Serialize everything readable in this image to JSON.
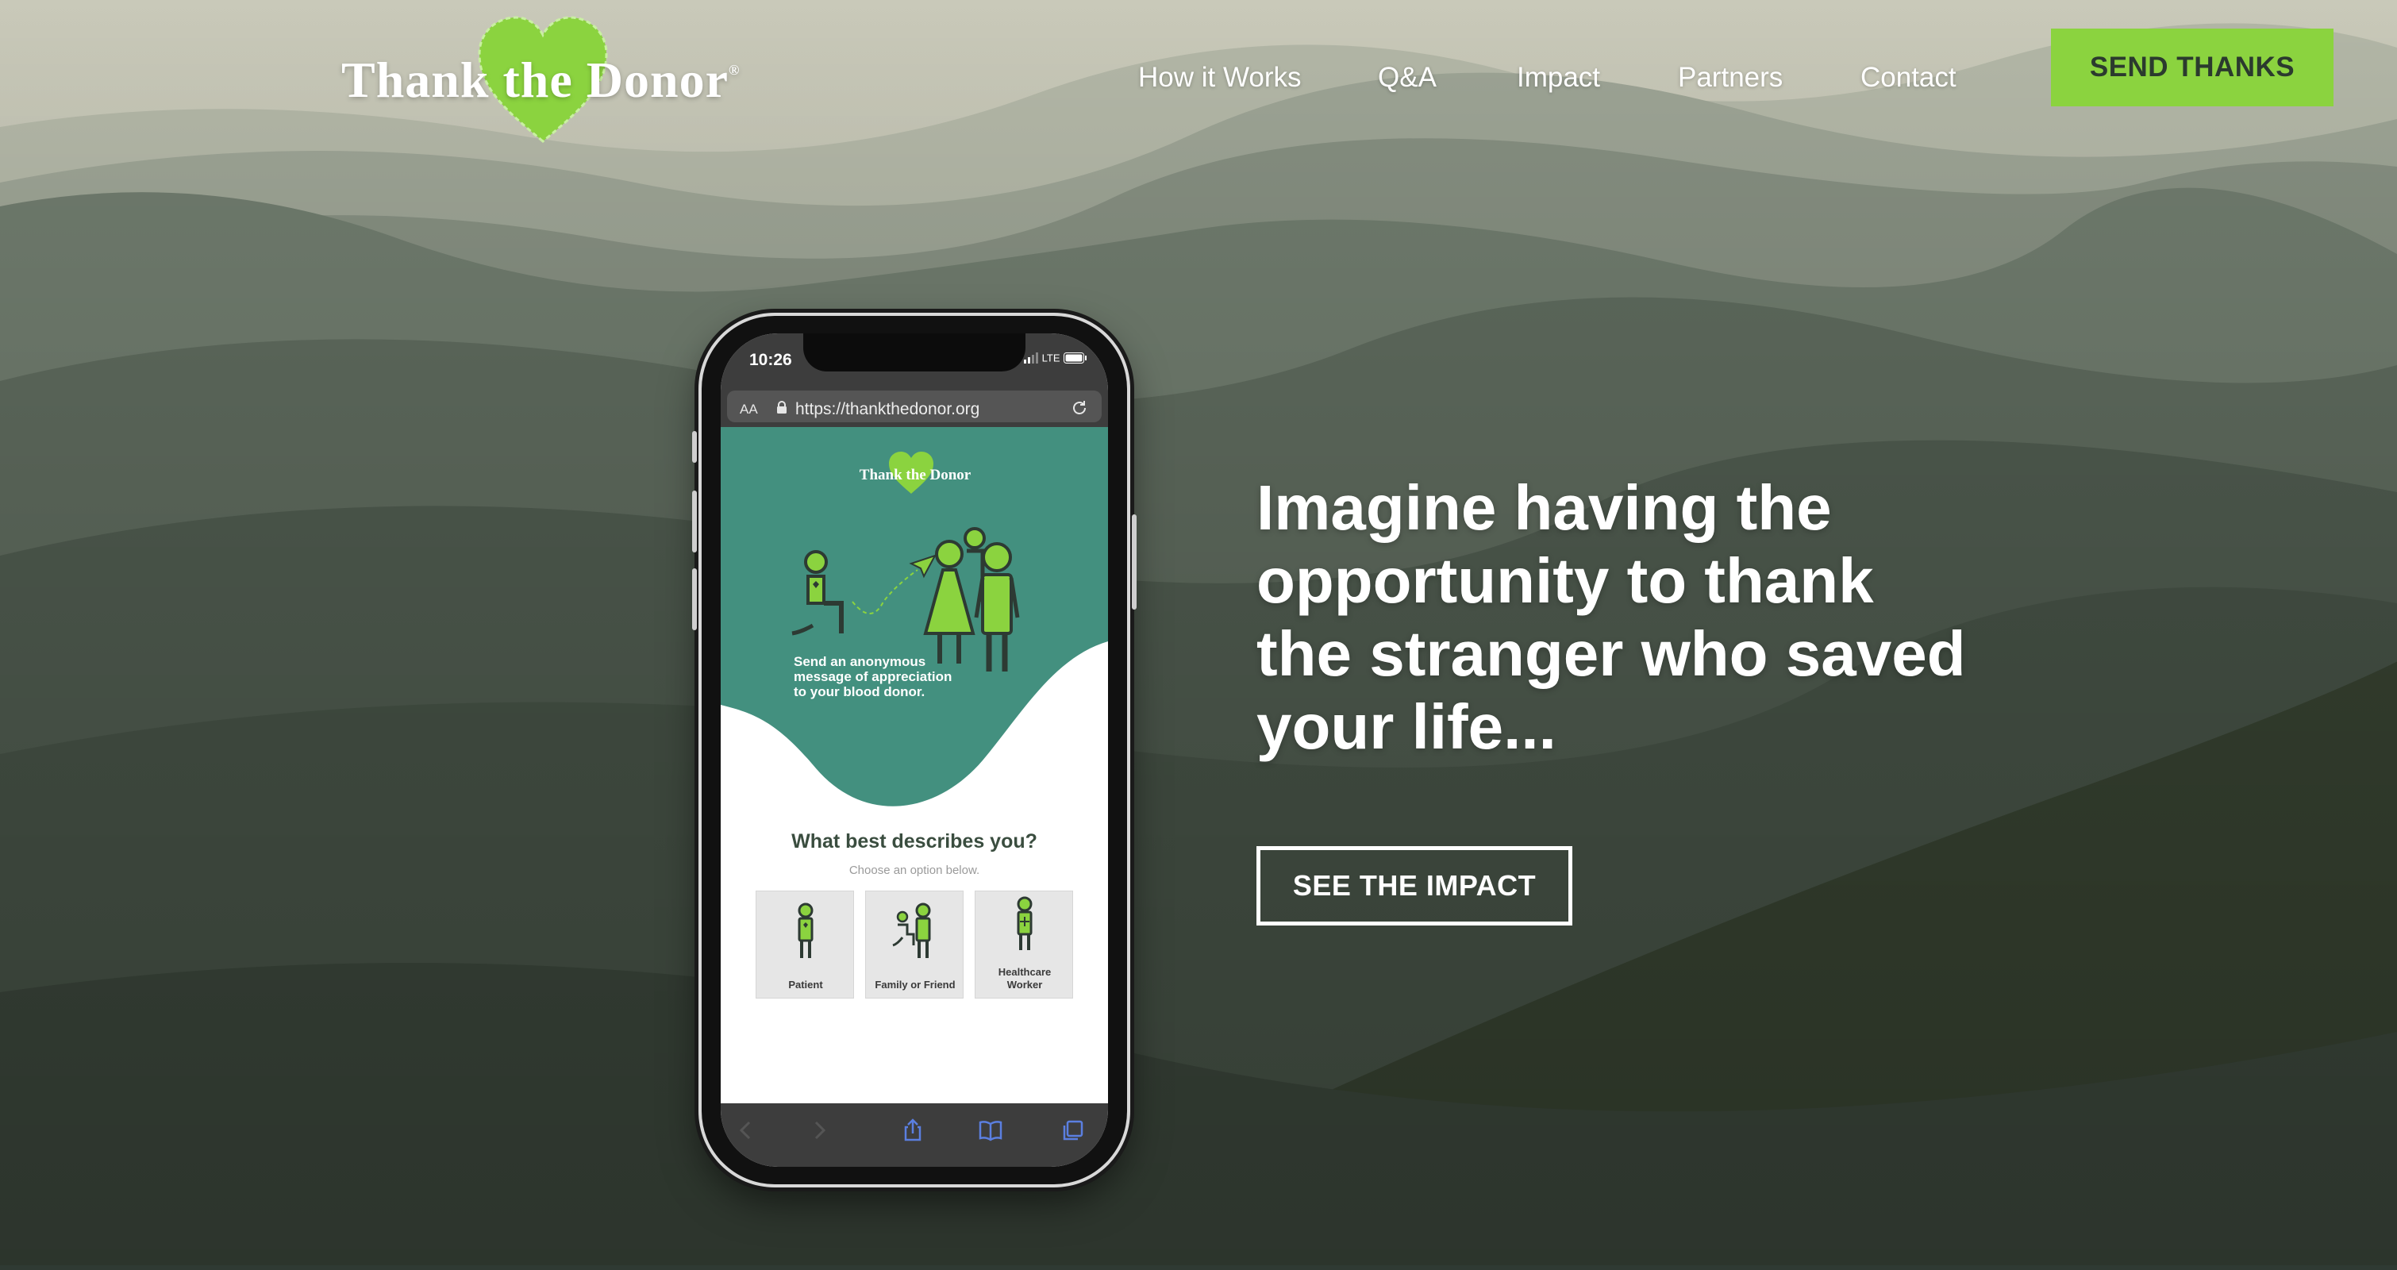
{
  "brand": {
    "logo_text": "Thank the Donor",
    "registered_mark": "®",
    "accent_color": "#8bd33f"
  },
  "nav": {
    "items": [
      {
        "label": "How it Works"
      },
      {
        "label": "Q&A"
      },
      {
        "label": "Impact"
      },
      {
        "label": "Partners"
      },
      {
        "label": "Contact"
      }
    ],
    "cta_label": "SEND THANKS"
  },
  "hero": {
    "headline": "Imagine having the opportunity to thank the stranger who saved your life...",
    "button_label": "SEE THE IMPACT"
  },
  "phone_mockup": {
    "time": "10:26",
    "network": "LTE",
    "text_size_label": "AA",
    "url": "https://thankthedonor.org",
    "logo_text": "Thank the Donor",
    "caption": "Send an anonymous message of appreciation to your blood donor.",
    "question": "What best describes you?",
    "question_hint": "Choose an option below.",
    "options": [
      {
        "label": "Patient"
      },
      {
        "label": "Family or Friend"
      },
      {
        "label": "Healthcare Worker"
      }
    ],
    "teal_color": "#43907f"
  }
}
